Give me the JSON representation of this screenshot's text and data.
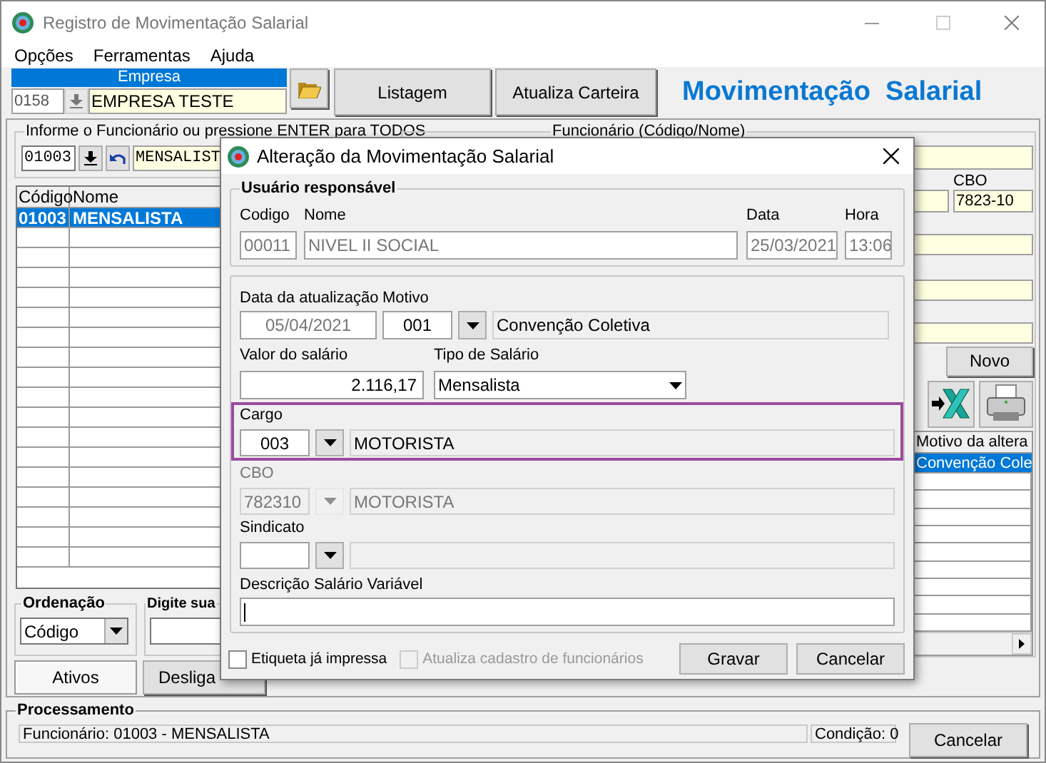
{
  "window": {
    "title": "Registro de Movimentação Salarial"
  },
  "menu": [
    "Opções",
    "Ferramentas",
    "Ajuda"
  ],
  "empresa": {
    "label": "Empresa",
    "code": "0158",
    "name": "EMPRESA TESTE"
  },
  "toolbar_buttons": [
    "Listagem",
    "Atualiza Carteira"
  ],
  "page_title": "Movimentação  Salarial",
  "employee_filter": {
    "legend": "Informe o Funcionário ou pressione ENTER para TODOS",
    "code": "01003",
    "name": "MENSALIST"
  },
  "employee_table": {
    "columns": [
      "Código",
      "Nome"
    ],
    "rows": [
      {
        "code": "01003",
        "name": "MENSALISTA",
        "selected": true
      }
    ]
  },
  "employee_panel": {
    "legend": "Funcionário (Código/Nome)",
    "cbo_label": "CBO",
    "cbo": "7823-10",
    "new_button": "Novo"
  },
  "history_table": {
    "columns": [
      "Motivo da altera"
    ],
    "rows": [
      {
        "cells": [
          "Convenção Cole"
        ],
        "selected": true
      }
    ]
  },
  "ordering": {
    "legend": "Ordenação",
    "value": "Código"
  },
  "search": {
    "legend": "Digite sua"
  },
  "tabs": [
    {
      "label": "Ativos",
      "selected": true
    },
    {
      "label": "Desliga",
      "selected": false
    }
  ],
  "processing": {
    "legend": "Processamento",
    "status": "Funcionário: 01003 - MENSALISTA",
    "condition": "Condição: 0",
    "cancel": "Cancelar"
  },
  "dialog": {
    "title": "Alteração da Movimentação Salarial",
    "user": {
      "legend": "Usuário responsável",
      "code_label": "Codigo",
      "code": "00011",
      "name_label": "Nome",
      "name": "NIVEL II SOCIAL",
      "date_label": "Data",
      "date": "25/03/2021",
      "time_label": "Hora",
      "time": "13:06"
    },
    "update_date_label": "Data da atualização",
    "update_date": "05/04/2021",
    "reason_label": "Motivo",
    "reason_code": "001",
    "reason": "Convenção Coletiva",
    "salary_label": "Valor do salário",
    "salary": "2.116,17",
    "salary_type_label": "Tipo de Salário",
    "salary_type": "Mensalista",
    "lookups": [
      {
        "label": "Cargo",
        "code": "003",
        "text": "MOTORISTA",
        "disabled": false,
        "highlighted": true
      },
      {
        "label": "CBO",
        "code": "782310",
        "text": "MOTORISTA",
        "disabled": true,
        "highlighted": false
      },
      {
        "label": "Sindicato",
        "disabled": false,
        "highlighted": false
      }
    ],
    "variable_label": "Descrição Salário Variável",
    "checkboxes": [
      {
        "label": "Etiqueta já impressa",
        "checked": false,
        "disabled": false
      },
      {
        "label": "Atualiza cadastro de funcionários",
        "checked": false,
        "disabled": true
      }
    ],
    "buttons": [
      "Gravar",
      "Cancelar"
    ]
  }
}
